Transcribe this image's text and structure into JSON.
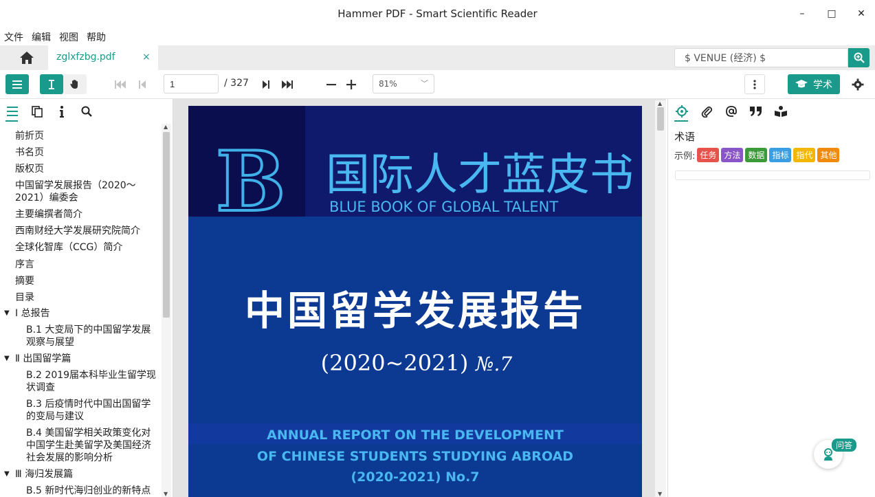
{
  "window": {
    "title": "Hammer PDF - Smart Scientific Reader",
    "minimize": "–",
    "maximize": "□",
    "close": "✕"
  },
  "menu": [
    "文件",
    "编辑",
    "视图",
    "帮助"
  ],
  "tab": {
    "name": "zglxfzbg.pdf",
    "close": "×"
  },
  "search": {
    "value": "$ VENUE (经济) $"
  },
  "toolbar": {
    "page_current": "1",
    "page_total": "/ 327",
    "zoom": "81%",
    "academic_label": "学术"
  },
  "outline": [
    {
      "label": "前折页",
      "level": 0
    },
    {
      "label": "书名页",
      "level": 0
    },
    {
      "label": "版权页",
      "level": 0
    },
    {
      "label": "中国留学发展报告（2020～",
      "cont": "2021）编委会",
      "level": 0
    },
    {
      "label": "主要编撰者简介",
      "level": 0
    },
    {
      "label": "西南财经大学发展研究院简介",
      "level": 0
    },
    {
      "label": "全球化智库（CCG）简介",
      "level": 0
    },
    {
      "label": "序言",
      "level": 0
    },
    {
      "label": "摘要",
      "level": 0
    },
    {
      "label": "目录",
      "level": 0
    },
    {
      "label": "Ⅰ 总报告",
      "level": 0,
      "expanded": true
    },
    {
      "label": "B.1 大变局下的中国留学发展",
      "cont": "观察与展望",
      "level": 1
    },
    {
      "label": "Ⅱ 出国留学篇",
      "level": 0,
      "expanded": true
    },
    {
      "label": "B.2 2019届本科毕业生留学现",
      "cont": "状调查",
      "level": 1
    },
    {
      "label": "B.3 后疫情时代中国出国留学",
      "cont": "的变局与建议",
      "level": 1
    },
    {
      "label": "B.4 美国留学相关政策变化对",
      "cont": "中国学生赴美留学及美国经济",
      "cont2": "社会发展的影响分析",
      "level": 1
    },
    {
      "label": "Ⅲ 海归发展篇",
      "level": 0,
      "expanded": true
    },
    {
      "label": "B.5 新时代海归创业的新特点",
      "level": 1
    }
  ],
  "pdf_page": {
    "cn_series": "国际人才蓝皮书",
    "en_series": "BLUE BOOK OF GLOBAL TALENT",
    "cn_title": "中国留学发展报告",
    "years": "(2020~2021)",
    "number": "№.7",
    "en_line1": "ANNUAL REPORT ON THE DEVELOPMENT",
    "en_line2": "OF CHINESE STUDENTS STUDYING ABROAD",
    "en_line3": "(2020-2021) No.7"
  },
  "right_panel": {
    "title": "术语",
    "example_label": "示例:",
    "tags": [
      {
        "label": "任务",
        "color": "#e5534b"
      },
      {
        "label": "方法",
        "color": "#8a55c6"
      },
      {
        "label": "数据",
        "color": "#3d9a3a"
      },
      {
        "label": "指标",
        "color": "#3a9ee3"
      },
      {
        "label": "指代",
        "color": "#f2b705"
      },
      {
        "label": "其他",
        "color": "#f08a0c"
      }
    ]
  },
  "qa": {
    "label": "问答"
  },
  "colors": {
    "accent": "#1a9a8a"
  }
}
